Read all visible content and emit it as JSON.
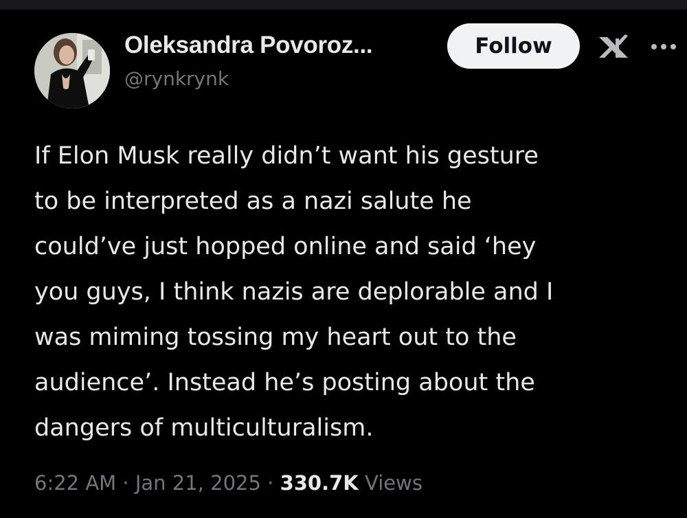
{
  "author": {
    "name": "Oleksandra Povoroz...",
    "handle": "@rynkrynk",
    "avatar_icon": "profile-photo"
  },
  "actions": {
    "follow_label": "Follow",
    "logo_icon": "x-logo-icon",
    "more_icon": "more-icon"
  },
  "tweet": {
    "lines": [
      "If Elon Musk really didn’t want his gesture",
      "to be interpreted as a nazi salute he",
      "could’ve just hopped online and said ‘hey",
      "you guys, I think nazis are deplorable and I",
      "was miming tossing my heart out to the",
      "audience’. Instead he’s posting about the",
      "dangers of multiculturalism."
    ]
  },
  "meta": {
    "time": "6:22 AM",
    "sep1": " · ",
    "date": "Jan 21, 2025",
    "sep2": " · ",
    "views_count": "330.7K",
    "views_label": "Views"
  },
  "colors": {
    "background": "#000000",
    "text": "#e7e9ea",
    "muted": "#71767b",
    "button_bg": "#eff3f4",
    "button_text": "#0f1419"
  }
}
